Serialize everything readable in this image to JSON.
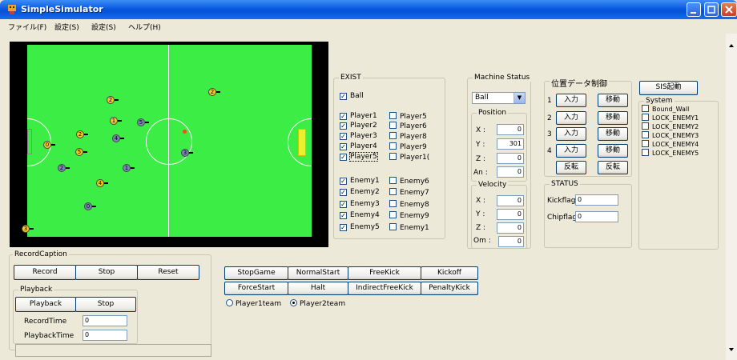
{
  "window": {
    "title": "SimpleSimulator"
  },
  "menu": [
    "ファイル(F)",
    "設定(S)",
    "設定(S)",
    "ヘルプ(H)"
  ],
  "field": {
    "robots": [
      {
        "label": "2",
        "team": "yellow"
      },
      {
        "label": "2",
        "team": "yellow"
      },
      {
        "label": "1",
        "team": "yellow"
      },
      {
        "label": "5",
        "team": "blue"
      },
      {
        "label": "2",
        "team": "yellow"
      },
      {
        "label": "4",
        "team": "blue"
      },
      {
        "label": "0",
        "team": "yellow"
      },
      {
        "label": "5",
        "team": "yellow"
      },
      {
        "label": "3",
        "team": "blue"
      },
      {
        "label": "2",
        "team": "blue"
      },
      {
        "label": "1",
        "team": "blue"
      },
      {
        "label": "4",
        "team": "yellow"
      },
      {
        "label": "0",
        "team": "blue"
      },
      {
        "label": "3",
        "team": "yellow"
      }
    ]
  },
  "exist": {
    "caption": "EXIST",
    "ball": {
      "label": "Ball",
      "checked": true
    },
    "players_left": [
      {
        "label": "Player1",
        "checked": true
      },
      {
        "label": "Player2",
        "checked": true
      },
      {
        "label": "Player3",
        "checked": true
      },
      {
        "label": "Player4",
        "checked": true
      },
      {
        "label": "Player5",
        "checked": true
      }
    ],
    "players_right": [
      {
        "label": "Player5",
        "checked": false
      },
      {
        "label": "Player6",
        "checked": false
      },
      {
        "label": "Player8",
        "checked": false
      },
      {
        "label": "Player9",
        "checked": false
      },
      {
        "label": "Player1(",
        "checked": false
      }
    ],
    "enemies_left": [
      {
        "label": "Enemy1",
        "checked": true
      },
      {
        "label": "Enemy2",
        "checked": true
      },
      {
        "label": "Enemy3",
        "checked": true
      },
      {
        "label": "Enemy4",
        "checked": true
      },
      {
        "label": "Enemy5",
        "checked": true
      }
    ],
    "enemies_right": [
      {
        "label": "Enemy6",
        "checked": false
      },
      {
        "label": "Enemy7",
        "checked": false
      },
      {
        "label": "Enemy8",
        "checked": false
      },
      {
        "label": "Enemy9",
        "checked": false
      },
      {
        "label": "Enemy1",
        "checked": false
      }
    ]
  },
  "machine": {
    "caption": "Machine Status",
    "selected": "Ball",
    "position": {
      "caption": "Position",
      "x_label": "X :",
      "x": "0",
      "y_label": "Y :",
      "y": "301",
      "z_label": "Z :",
      "z": "0",
      "an_label": "An :",
      "an": "0"
    },
    "velocity": {
      "caption": "Velocity",
      "x_label": "X :",
      "x": "0",
      "y_label": "Y :",
      "y": "0",
      "z_label": "Z :",
      "z": "0",
      "om_label": "Om :",
      "om": "0"
    }
  },
  "posctrl": {
    "caption": "位置データ制御",
    "rows": [
      {
        "num": "1",
        "input": "入力",
        "move": "移動"
      },
      {
        "num": "2",
        "input": "入力",
        "move": "移動"
      },
      {
        "num": "3",
        "input": "入力",
        "move": "移動"
      },
      {
        "num": "4",
        "input": "入力",
        "move": "移動"
      }
    ],
    "invert1": "反転",
    "invert2": "反転"
  },
  "status": {
    "caption": "STATUS",
    "kick_label": "Kickflag",
    "kick": "0",
    "chip_label": "Chipflag",
    "chip": "0"
  },
  "sis_button": "SIS起動",
  "system": {
    "caption": "System",
    "items": [
      {
        "label": "Bound_Wall",
        "checked": false
      },
      {
        "label": "LOCK_ENEMY1",
        "checked": false
      },
      {
        "label": "LOCK_ENEMY2",
        "checked": false
      },
      {
        "label": "LOCK_ENEMY3",
        "checked": false
      },
      {
        "label": "LOCK_ENEMY4",
        "checked": false
      },
      {
        "label": "LOCK_ENEMY5",
        "checked": false
      }
    ]
  },
  "record": {
    "caption": "RecordCaption",
    "record": "Record",
    "stop": "Stop",
    "reset": "Reset"
  },
  "playback": {
    "caption": "Playback",
    "playback": "Playback",
    "stop": "Stop",
    "record_time_label": "RecordTime",
    "record_time": "0",
    "playback_time_label": "PlaybackTime",
    "playback_time": "0"
  },
  "referee": {
    "buttons": [
      "StopGame",
      "NormalStart",
      "FreeKick",
      "Kickoff",
      "ForceStart",
      "Halt",
      "IndirectFreeKick",
      "PenaltyKick"
    ],
    "team1": "Player1team",
    "team2": "Player2team",
    "selected_team": "Player2team"
  }
}
